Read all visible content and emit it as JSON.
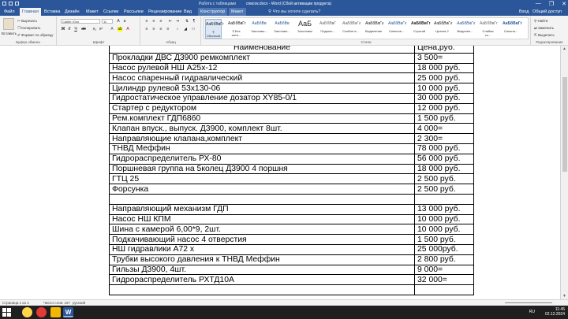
{
  "window": {
    "title": "список.docx - Word (Сбой активации продукта)",
    "context_group": "Работа с таблицами",
    "buttons": [
      "—",
      "❐",
      "✕"
    ]
  },
  "tabs": [
    {
      "label": "Файл"
    },
    {
      "label": "Главная"
    },
    {
      "label": "Вставка"
    },
    {
      "label": "Дизайн"
    },
    {
      "label": "Макет"
    },
    {
      "label": "Ссылки"
    },
    {
      "label": "Рассылки"
    },
    {
      "label": "Рецензирование"
    },
    {
      "label": "Вид"
    },
    {
      "label": "Конструктор"
    },
    {
      "label": "Макет"
    }
  ],
  "tell_me": "Что вы хотите сделать?",
  "sign_in": "Вход",
  "share": "Общий доступ",
  "ribbon": {
    "clipboard": {
      "paste": "Вставить",
      "cut": "Вырезать",
      "copy": "Копировать",
      "format_painter": "Формат по образцу",
      "label": "Буфер обмена"
    },
    "font": {
      "family": "Calibri (Осн",
      "size": "11",
      "label": "Шрифт"
    },
    "paragraph": {
      "label": "Абзац"
    },
    "styles": {
      "label": "Стили",
      "items": [
        {
          "sample": "АаБбВвГг",
          "name": "¶ Обычный"
        },
        {
          "sample": "АаБбВвГг",
          "name": "¶ Без инте..."
        },
        {
          "sample": "АаБбВв",
          "name": "Заголово..."
        },
        {
          "sample": "АаБбВв",
          "name": "Заголово..."
        },
        {
          "sample": "АаБ",
          "name": "Заголовок"
        },
        {
          "sample": "АаБбВвГ",
          "name": "Подзаго..."
        },
        {
          "sample": "АаБбВвГг",
          "name": "Слабое в..."
        },
        {
          "sample": "АаБбВвГг",
          "name": "Выделение"
        },
        {
          "sample": "АаБбВвГг",
          "name": "Сильное..."
        },
        {
          "sample": "АаБбВвГг",
          "name": "Строгий"
        },
        {
          "sample": "АаБбВвГг",
          "name": "Цитата 2"
        },
        {
          "sample": "АаБбВвГг",
          "name": "Выделен..."
        },
        {
          "sample": "АаБбВвГг",
          "name": "Слабая сс..."
        },
        {
          "sample": "АаБбВвГг",
          "name": "Сильна..."
        }
      ]
    },
    "editing": {
      "find": "Найти",
      "replace": "Заменить",
      "select": "Выделить",
      "label": "Редактирование"
    }
  },
  "table": {
    "header": {
      "name": "Наименование",
      "price": "Цена,руб."
    },
    "rows": [
      {
        "name": "Прокладки ДВС Д3900 ремкомплект",
        "price": "3 500="
      },
      {
        "name": "Насос рулевой НШ А25х-12",
        "price": "18 000 руб."
      },
      {
        "name": "Насос спаренный гидравлический",
        "price": "25 000 руб."
      },
      {
        "name": "Цилиндр рулевой 53х130-06",
        "price": "10 000 руб."
      },
      {
        "name": "Гидростатическое управление дозатор XY85-0/1",
        "price": "30 000 руб."
      },
      {
        "name": "Стартер с редуктором",
        "price": "12 000 руб."
      },
      {
        "name": "Рем.комплект ГДП6860",
        "price": "1 500 руб."
      },
      {
        "name": "Клапан впуск., выпуск. Д3900, комплект 8шт.",
        "price": "4 000="
      },
      {
        "name": "Направляющие клапана,комплект",
        "price": "2 300="
      },
      {
        "name": "ТНВД Меффин",
        "price": "78 000 руб."
      },
      {
        "name": "Гидрораспределитель РХ-80",
        "price": "56 000 руб."
      },
      {
        "name": "Поршневая группа на 5колец  Д3900 4 поршня",
        "price": "18 000 руб."
      },
      {
        "name": "ГТЦ 25",
        "price": "2 500 руб."
      },
      {
        "name": "Форсунка",
        "price": "2 500 руб."
      },
      {
        "name": "",
        "price": ""
      },
      {
        "name": "Направляющий механизм ГДП",
        "price": "13 000 руб."
      },
      {
        "name": "Насос НШ КПМ",
        "price": "10 000 руб."
      },
      {
        "name": "Шина с камерой 6,00*9, 2шт.",
        "price": "10 000 руб."
      },
      {
        "name": "Подкачивающий насос 4 отверстия",
        "price": "1 500 руб."
      },
      {
        "name": "НШ гидравлики А72 х",
        "price": "25 000руб."
      },
      {
        "name": "Трубки высокого давления к ТНВД Меффин",
        "price": "2 800 руб."
      },
      {
        "name": "Гильзы Д3900, 4шт.",
        "price": "9 000="
      },
      {
        "name": "Гидрораспределитель РХТД10А",
        "price": "32 000="
      },
      {
        "name": "",
        "price": ""
      }
    ]
  },
  "status": {
    "page": "Страница 1 из 1",
    "words": "Число слов: 157",
    "language": "русский"
  },
  "taskbar": {
    "lang": "RU",
    "time": "11:45",
    "date": "02.12.2024"
  },
  "colors": {
    "word_blue": "#2b579a",
    "ribbon_bg": "#f3f3f3",
    "taskbar_bg": "#1f1f1f"
  }
}
